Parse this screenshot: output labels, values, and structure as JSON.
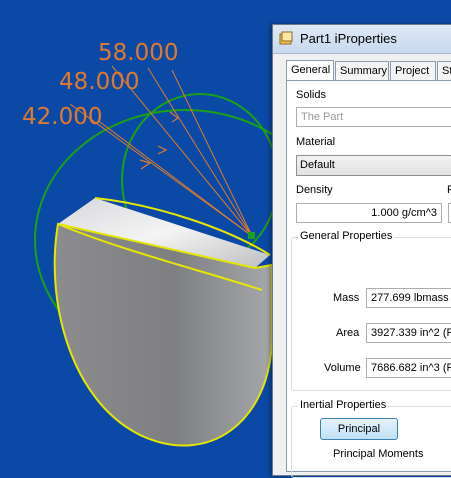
{
  "viewport": {
    "background_color": "#0b49a6",
    "dimensions": [
      "58.000",
      "48.000",
      "42.000"
    ],
    "dimension_color": "#e07a2a",
    "sketch_color": "#1aa01a",
    "edge_highlight_color": "#e6e600"
  },
  "dialog": {
    "title": "Part1 iProperties",
    "tabs": [
      "General",
      "Summary",
      "Project",
      "St"
    ],
    "solids_label": "Solids",
    "solids_value": "The Part",
    "material_label": "Material",
    "material_value": "Default",
    "density_label": "Density",
    "density_value": "1.000 g/cm^3",
    "density_side_label": "R",
    "general_properties": {
      "title": "General Properties",
      "mass_label": "Mass",
      "mass_value": "277.699 lbmass (",
      "area_label": "Area",
      "area_value": "3927.339 in^2 (R",
      "volume_label": "Volume",
      "volume_value": "7686.682 in^3 (R"
    },
    "inertial_properties": {
      "title": "Inertial Properties",
      "principal_button": "Principal",
      "principal_moments_label": "Principal Moments"
    }
  }
}
